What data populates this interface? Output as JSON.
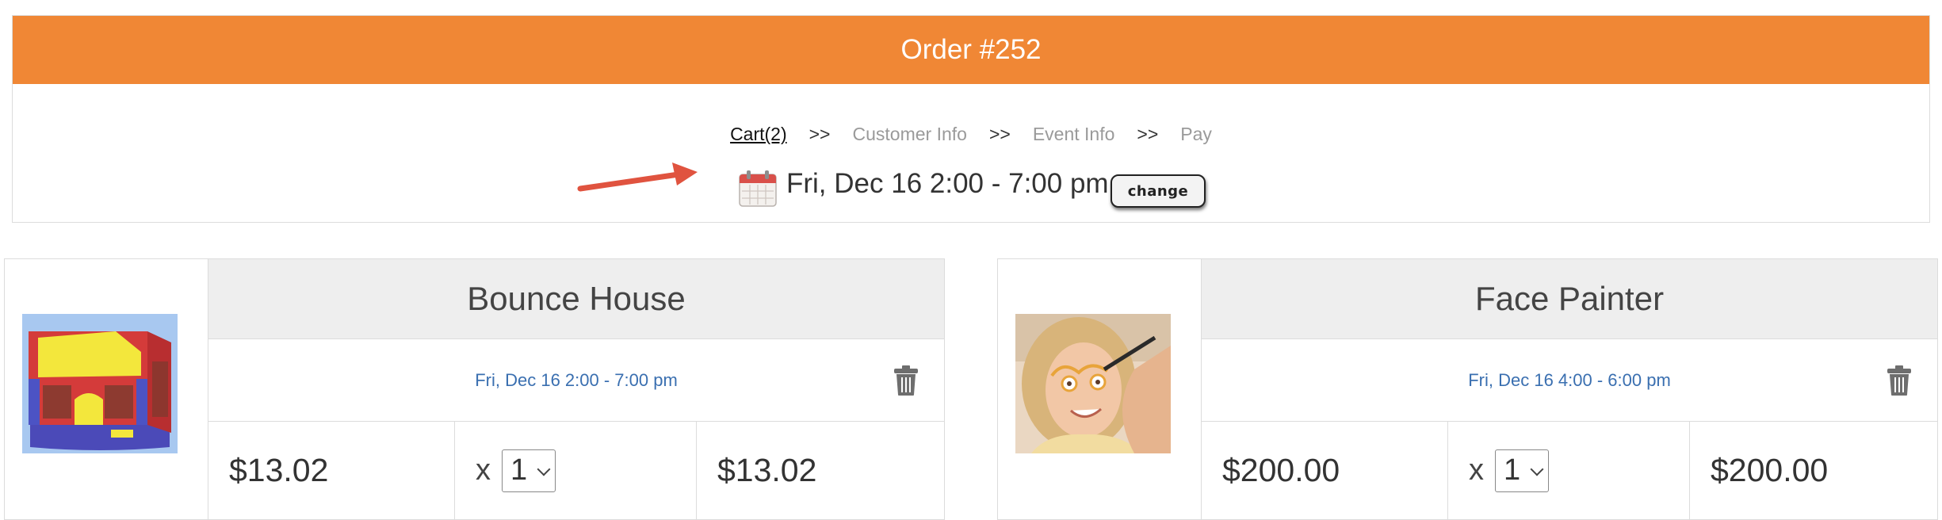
{
  "order": {
    "title": "Order #252",
    "breadcrumb": [
      {
        "label": "Cart(2)"
      },
      {
        "label": ">>"
      },
      {
        "label": "Customer Info"
      },
      {
        "label": ">>"
      },
      {
        "label": "Event Info"
      },
      {
        "label": ">>"
      },
      {
        "label": "Pay"
      }
    ],
    "date": "Fri, Dec 16 2:00 - 7:00 pm",
    "change_label": "CHANGE"
  },
  "colors": {
    "header": "#f08735",
    "date_link": "#3a6fb0",
    "arrow": "#e0533f"
  },
  "items": [
    {
      "title": "Bounce House",
      "date": "Fri, Dec 16 2:00 - 7:00 pm",
      "unit_price": "$13.02",
      "qty_x": "x",
      "qty": "1",
      "total": "$13.02"
    },
    {
      "title": "Face Painter",
      "date": "Fri, Dec 16 4:00 - 6:00 pm",
      "unit_price": "$200.00",
      "qty_x": "x",
      "qty": "1",
      "total": "$200.00"
    }
  ]
}
